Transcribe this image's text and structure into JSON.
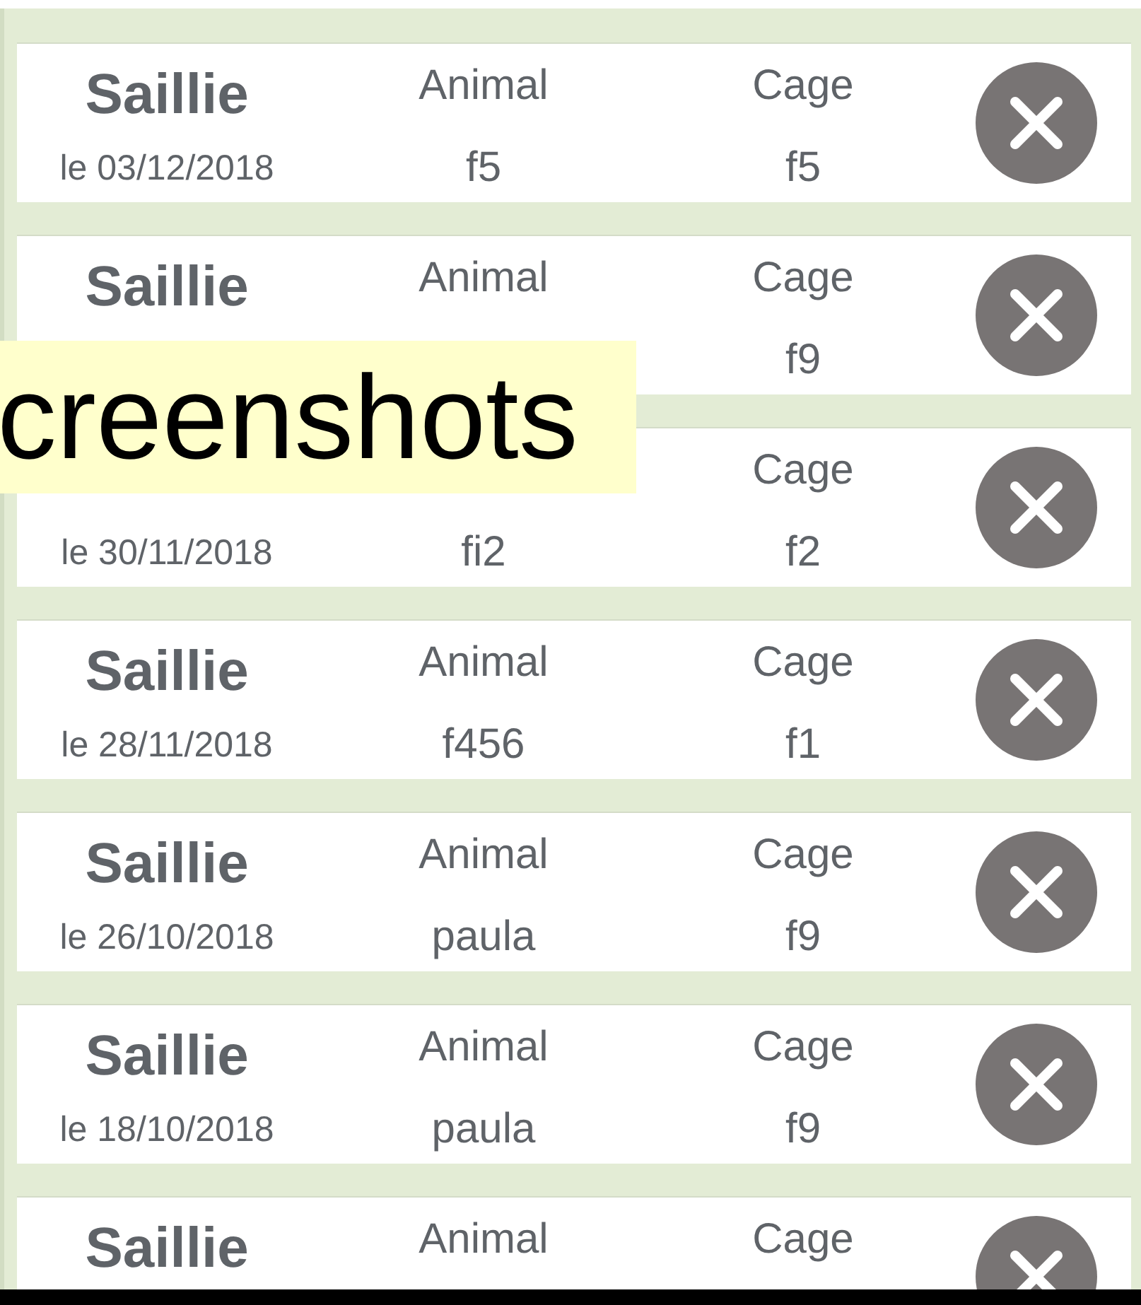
{
  "records": [
    {
      "title": "Saillie",
      "date": "le 03/12/2018",
      "animal_label": "Animal",
      "animal": "f5",
      "cage_label": "Cage",
      "cage": "f5"
    },
    {
      "title": "Saillie",
      "animal_label": "Animal",
      "cage_label": "Cage",
      "cage": "f9"
    },
    {
      "date": "le 30/11/2018",
      "animal": "fi2",
      "cage_label": "Cage",
      "cage": "f2"
    },
    {
      "title": "Saillie",
      "date": "le 28/11/2018",
      "animal_label": "Animal",
      "animal": "f456",
      "cage_label": "Cage",
      "cage": "f1"
    },
    {
      "title": "Saillie",
      "date": "le 26/10/2018",
      "animal_label": "Animal",
      "animal": "paula",
      "cage_label": "Cage",
      "cage": "f9"
    },
    {
      "title": "Saillie",
      "date": "le 18/10/2018",
      "animal_label": "Animal",
      "animal": "paula",
      "cage_label": "Cage",
      "cage": "f9"
    },
    {
      "title": "Saillie",
      "animal_label": "Animal",
      "cage_label": "Cage"
    }
  ],
  "overlay_label": "creenshots"
}
